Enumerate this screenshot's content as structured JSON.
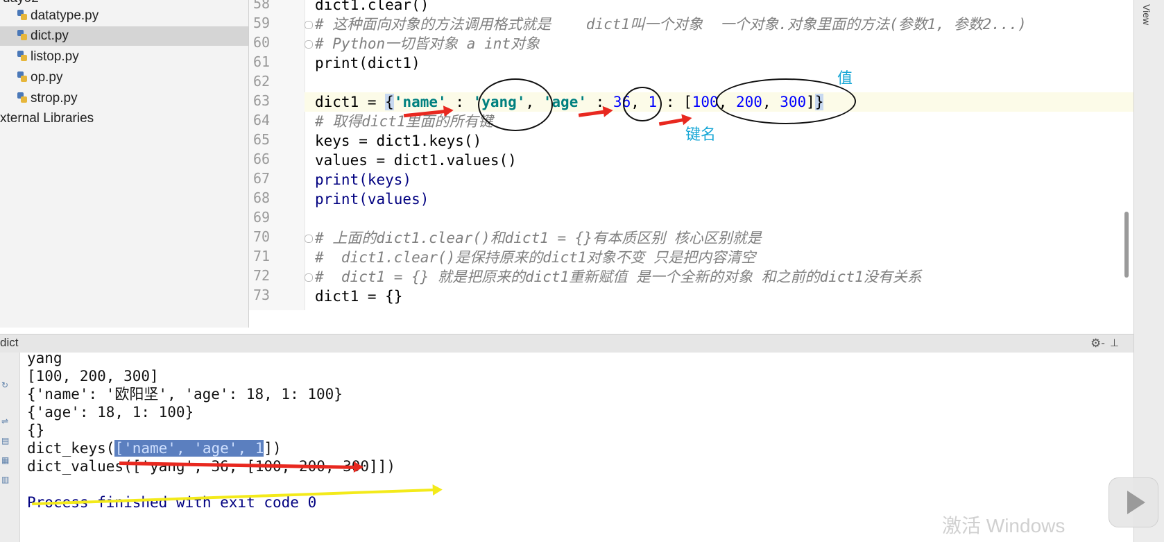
{
  "project_tree": {
    "partial_top": "day02",
    "items": [
      {
        "label": "datatype.py",
        "selected": false
      },
      {
        "label": "dict.py",
        "selected": true
      },
      {
        "label": "listop.py",
        "selected": false
      },
      {
        "label": "op.py",
        "selected": false
      },
      {
        "label": "strop.py",
        "selected": false
      }
    ],
    "external": "xternal Libraries"
  },
  "editor": {
    "lines": [
      {
        "num": "58",
        "text": "dict1.clear()"
      },
      {
        "num": "59",
        "text": "# 这种面向对象的方法调用格式就是    dict1叫一个对象  一个对象.对象里面的方法(参数1, 参数2...)"
      },
      {
        "num": "60",
        "text": "# Python一切皆对象 a int对象"
      },
      {
        "num": "61",
        "text": "print(dict1)"
      },
      {
        "num": "62",
        "text": ""
      },
      {
        "num": "63",
        "text": "dict1 = {'name' : 'yang', 'age' : 36, 1 : [100, 200, 300]}"
      },
      {
        "num": "64",
        "text": "# 取得dict1里面的所有键"
      },
      {
        "num": "65",
        "text": "keys = dict1.keys()"
      },
      {
        "num": "66",
        "text": "values = dict1.values()"
      },
      {
        "num": "67",
        "text": "print(keys)"
      },
      {
        "num": "68",
        "text": "print(values)"
      },
      {
        "num": "69",
        "text": ""
      },
      {
        "num": "70",
        "text": "# 上面的dict1.clear()和dict1 = {}有本质区别 核心区别就是"
      },
      {
        "num": "71",
        "text": "#  dict1.clear()是保持原来的dict1对象不变 只是把内容清空"
      },
      {
        "num": "72",
        "text": "#  dict1 = {} 就是把原来的dict1重新赋值 是一个全新的对象 和之前的dict1没有关系"
      },
      {
        "num": "73",
        "text": "dict1 = {}"
      }
    ],
    "tokens63": {
      "a": "dict1 = ",
      "b": "{",
      "c": "'name'",
      "d": " : ",
      "e": "'yang'",
      "f": ", ",
      "g": "'age'",
      "h": " : ",
      "i": "36",
      "j": ", ",
      "k": "1",
      "l": " : ",
      "m": "[",
      "n": "100",
      "o": ", ",
      "p": "200",
      "q": ", ",
      "r": "300",
      "s": "]",
      "t": "}"
    }
  },
  "annotations": {
    "value_label": "值",
    "key_label": "键名"
  },
  "right_stripe": {
    "label": "View"
  },
  "run_panel": {
    "title": "dict",
    "gear": "⚙-",
    "pin": "⊥",
    "lines": [
      "yang",
      "[100, 200, 300]",
      "{'name': '欧阳坚', 'age': 18, 1: 100}",
      "{'age': 18, 1: 100}",
      "{}",
      "dict_keys(['name', 'age', 1])",
      "dict_values(['yang', 36, [100, 200, 300]])",
      "",
      "Process finished with exit code 0"
    ],
    "keys_prefix": "dict_keys(",
    "keys_selected": "['name', 'age', 1",
    "keys_suffix": "])"
  },
  "watermark": "激活 Windows"
}
